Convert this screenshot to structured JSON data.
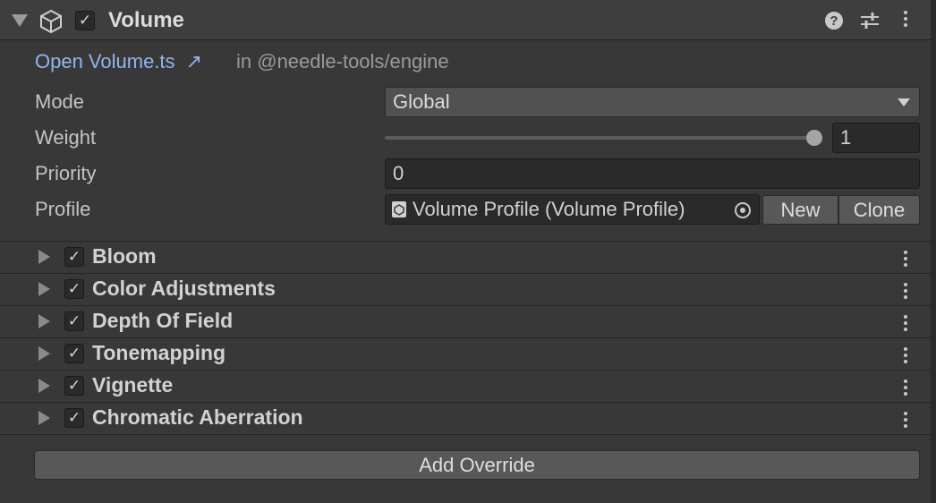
{
  "component": {
    "title": "Volume",
    "enabled": true,
    "icons": [
      "fold-arrow",
      "cube-icon",
      "checkbox",
      "help-icon",
      "preset-icon",
      "kebab-menu-icon"
    ]
  },
  "script_link": {
    "text": "Open Volume.ts",
    "arrow": "↗",
    "package": "in @needle-tools/engine"
  },
  "properties": {
    "mode": {
      "label": "Mode",
      "value": "Global"
    },
    "weight": {
      "label": "Weight",
      "value": "1",
      "slider_fraction": 1.0
    },
    "priority": {
      "label": "Priority",
      "value": "0"
    },
    "profile": {
      "label": "Profile",
      "value": "Volume Profile (Volume Profile)",
      "new_label": "New",
      "clone_label": "Clone"
    }
  },
  "overrides": [
    {
      "label": "Bloom",
      "enabled": true
    },
    {
      "label": "Color Adjustments",
      "enabled": true
    },
    {
      "label": "Depth Of Field",
      "enabled": true
    },
    {
      "label": "Tonemapping",
      "enabled": true
    },
    {
      "label": "Vignette",
      "enabled": true
    },
    {
      "label": "Chromatic Aberration",
      "enabled": true
    }
  ],
  "add_override_label": "Add Override",
  "colors": {
    "link": "#8fb6ee",
    "background": "#383838",
    "header": "#3e3e3e"
  }
}
